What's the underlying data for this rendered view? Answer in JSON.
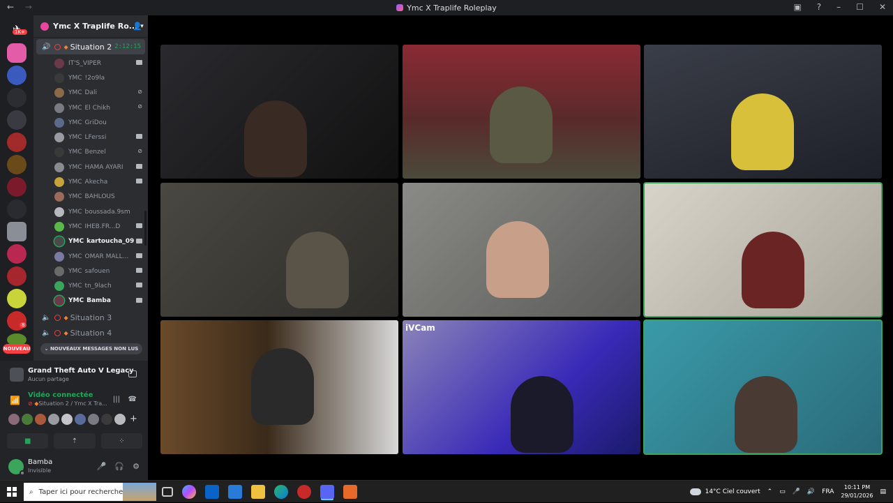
{
  "titlebar": {
    "title": "Ymc X Traplife Roleplay",
    "back_icon": "←",
    "forward_icon": "→"
  },
  "servers": {
    "badge_top": "1K+",
    "badge_dm": "8",
    "new_label": "NOUVEAU"
  },
  "guild": {
    "name": "Ymc X Traplife Ro..."
  },
  "channels": {
    "active": {
      "name": "Situation 2",
      "timer": "2:12:15"
    },
    "members": [
      {
        "prefix": "",
        "name": "IT'S_VIPER",
        "cam": true
      },
      {
        "prefix": "YMC",
        "name": "!2o9la",
        "cam": false
      },
      {
        "prefix": "YMC",
        "name": "Dali",
        "deaf": true
      },
      {
        "prefix": "YMC",
        "name": "El Chikh",
        "deaf": true
      },
      {
        "prefix": "YMC",
        "name": "GriDou",
        "cam": false
      },
      {
        "prefix": "YMC",
        "name": "LFerssi",
        "cam": true
      },
      {
        "prefix": "YMC",
        "name": "Benzel",
        "deaf": true
      },
      {
        "prefix": "YMC",
        "name": "HAMA AYARI",
        "cam": true
      },
      {
        "prefix": "YMC",
        "name": "Akecha",
        "cam": true
      },
      {
        "prefix": "YMC",
        "name": "BAHLOUS",
        "cam": false
      },
      {
        "prefix": "YMC",
        "name": "boussada.9sm",
        "cam": false
      },
      {
        "prefix": "YMC",
        "name": "IHEB.FR...D",
        "cam": true
      },
      {
        "prefix": "YMC",
        "name": "kartoucha_09",
        "cam": true,
        "bold": true
      },
      {
        "prefix": "YMC",
        "name": "OMAR MALL...",
        "cam": true
      },
      {
        "prefix": "YMC",
        "name": "safouen",
        "cam": true
      },
      {
        "prefix": "YMC",
        "name": "tn_9lach",
        "cam": true
      },
      {
        "prefix": "YMC",
        "name": "Bamba",
        "cam": true,
        "bold": true
      }
    ],
    "other": [
      {
        "name": "Situation 3"
      },
      {
        "name": "Situation 4"
      }
    ],
    "unread_pill": "NOUVEAUX MESSAGES NON LUS"
  },
  "activity": {
    "game": "Grand Theft Auto V Legacy",
    "sharing": "Aucun partage"
  },
  "voice": {
    "status": "Vidéo connectée",
    "channel": "Situation 2 / Ymc X Tra..."
  },
  "user": {
    "name": "Bamba",
    "status": "Invisible"
  },
  "taskbar": {
    "search_placeholder": "Taper ici pour rechercher",
    "weather": "14°C  Ciel couvert",
    "lang": "FRA",
    "time": "10:11 PM",
    "date": "29/01/2026"
  }
}
